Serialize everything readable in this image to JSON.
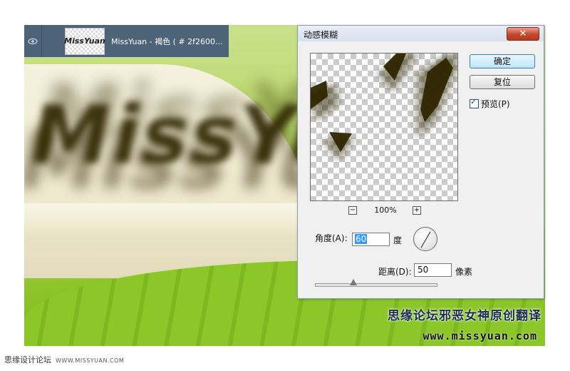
{
  "layer": {
    "name": "MissYuan - 褐色 ( # 2f2600...",
    "thumbnail_text": "MissYuan",
    "eye_icon": "eye-icon"
  },
  "canvas": {
    "text": "MissYuan",
    "text_color": "#2f2600"
  },
  "dialog": {
    "title": "动感模糊",
    "close_label": "✕",
    "ok_label": "确定",
    "reset_label": "复位",
    "preview_label": "预览(P)",
    "preview_checked": true,
    "zoom_minus": "−",
    "zoom_plus": "+",
    "zoom_level": "100%",
    "angle_label": "角度(A):",
    "angle_value": "60",
    "angle_unit": "度",
    "distance_label": "距离(D):",
    "distance_value": "50",
    "distance_unit": "像素",
    "distance_slider_fraction": 0.05
  },
  "banner": {
    "chinese": "思缘论坛邪恶女神原创翻译",
    "url": "www.missyuan.com"
  },
  "footer": {
    "cn": "思缘设计论坛",
    "site": "WWW.MISSYUAN.COM"
  }
}
